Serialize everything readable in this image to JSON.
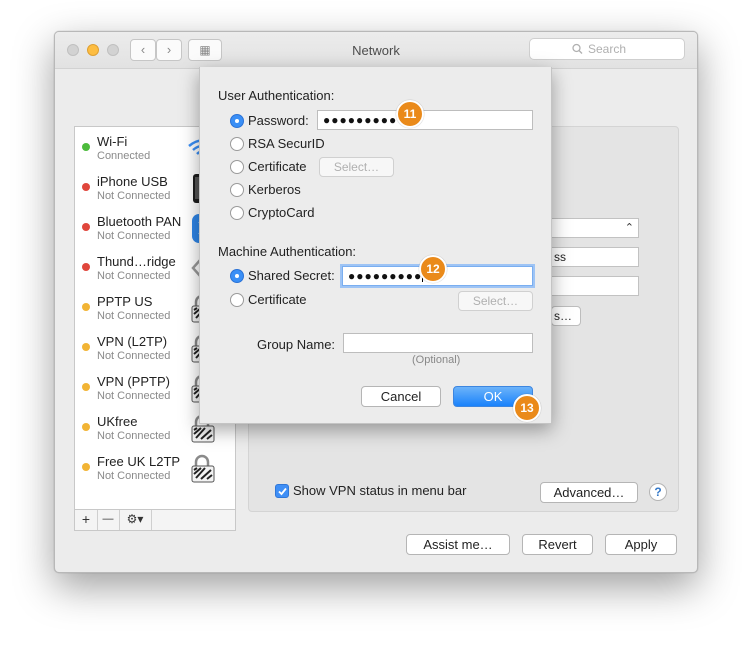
{
  "window": {
    "title": "Network",
    "search_placeholder": "Search",
    "nav": {
      "back": "‹",
      "forward": "›",
      "grid": "▦"
    }
  },
  "sidebar": {
    "services": [
      {
        "name": "Wi-Fi",
        "status": "Connected",
        "dot": "#4cbb3c",
        "icon": "wifi-icon"
      },
      {
        "name": "iPhone USB",
        "status": "Not Connected",
        "dot": "#e0463c",
        "icon": "iphone-icon"
      },
      {
        "name": "Bluetooth PAN",
        "status": "Not Connected",
        "dot": "#e0463c",
        "icon": "bluetooth-icon"
      },
      {
        "name": "Thund…ridge",
        "status": "Not Connected",
        "dot": "#e0463c",
        "icon": "thunderbolt-icon"
      },
      {
        "name": "PPTP US",
        "status": "Not Connected",
        "dot": "#f2b435",
        "icon": "vpn-lock-icon"
      },
      {
        "name": "VPN (L2TP)",
        "status": "Not Connected",
        "dot": "#f2b435",
        "icon": "vpn-lock-icon"
      },
      {
        "name": "VPN (PPTP)",
        "status": "Not Connected",
        "dot": "#f2b435",
        "icon": "vpn-lock-icon"
      },
      {
        "name": "UKfree",
        "status": "Not Connected",
        "dot": "#f2b435",
        "icon": "vpn-lock-icon"
      },
      {
        "name": "Free UK L2TP",
        "status": "Not Connected",
        "dot": "#f2b435",
        "icon": "vpn-lock-icon"
      }
    ],
    "toolbar": {
      "add": "+",
      "remove": "—",
      "gear": "⚙▾"
    }
  },
  "detail": {
    "obscured_field_text": "ss",
    "obscured_button_text": "s…",
    "show_vpn_label": "Show VPN status in menu bar",
    "show_vpn_checked": true,
    "advanced_button": "Advanced…",
    "help": "?"
  },
  "footer": {
    "assist": "Assist me…",
    "revert": "Revert",
    "apply": "Apply"
  },
  "sheet": {
    "user_auth_heading": "User Authentication:",
    "user_options": [
      {
        "label": "Password:",
        "selected": true
      },
      {
        "label": "RSA SecurID",
        "selected": false
      },
      {
        "label": "Certificate",
        "selected": false
      },
      {
        "label": "Kerberos",
        "selected": false
      },
      {
        "label": "CryptoCard",
        "selected": false
      }
    ],
    "password_value": "●●●●●●●●●",
    "select_button": "Select…",
    "machine_auth_heading": "Machine Authentication:",
    "machine_options": [
      {
        "label": "Shared Secret:",
        "selected": true
      },
      {
        "label": "Certificate",
        "selected": false
      }
    ],
    "shared_secret_value": "●●●●●●●●●",
    "machine_select_button": "Select…",
    "group_name_label": "Group Name:",
    "group_name_value": "",
    "optional_hint": "(Optional)",
    "cancel": "Cancel",
    "ok": "OK"
  },
  "annotations": {
    "badge_password": "11",
    "badge_secret": "12",
    "badge_ok": "13",
    "color": "#ea8a1a"
  },
  "colors": {
    "accent": "#3a8ff6",
    "connected": "#4cbb3c",
    "disconnected": "#e0463c",
    "inactive": "#f2b435"
  }
}
